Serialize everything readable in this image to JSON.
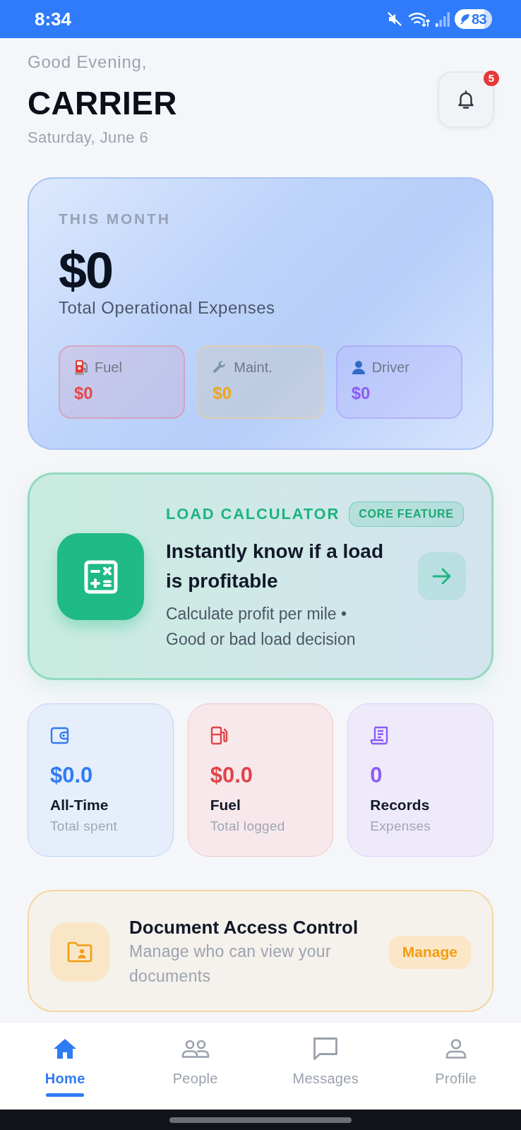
{
  "status_bar": {
    "time": "8:34",
    "battery": "83"
  },
  "header": {
    "greeting": "Good Evening,",
    "name": "CARRIER",
    "date": "Saturday, June 6",
    "notification_count": "5"
  },
  "month_summary": {
    "label": "THIS MONTH",
    "amount": "$0",
    "caption": "Total Operational Expenses",
    "breakdown": [
      {
        "kind": "fuel",
        "label": "Fuel",
        "value": "$0"
      },
      {
        "kind": "maintenance",
        "label": "Maint.",
        "value": "$0"
      },
      {
        "kind": "driver",
        "label": "Driver",
        "value": "$0"
      }
    ]
  },
  "load_calculator": {
    "title": "LOAD CALCULATOR",
    "badge": "CORE FEATURE",
    "heading": "Instantly know if a load is profitable",
    "description": "Calculate profit per mile • Good or bad load decision"
  },
  "stats": [
    {
      "kind": "wallet",
      "value": "$0.0",
      "label": "All-Time",
      "caption": "Total spent"
    },
    {
      "kind": "fuel",
      "value": "$0.0",
      "label": "Fuel",
      "caption": "Total logged"
    },
    {
      "kind": "records",
      "value": "0",
      "label": "Records",
      "caption": "Expenses"
    }
  ],
  "document_access": {
    "title": "Document Access Control",
    "description": "Manage who can view your documents",
    "button": "Manage"
  },
  "bottom_nav": [
    {
      "kind": "home",
      "label": "Home",
      "selected": true
    },
    {
      "kind": "people",
      "label": "People",
      "selected": false
    },
    {
      "kind": "messages",
      "label": "Messages",
      "selected": false
    },
    {
      "kind": "profile",
      "label": "Profile",
      "selected": false
    }
  ]
}
